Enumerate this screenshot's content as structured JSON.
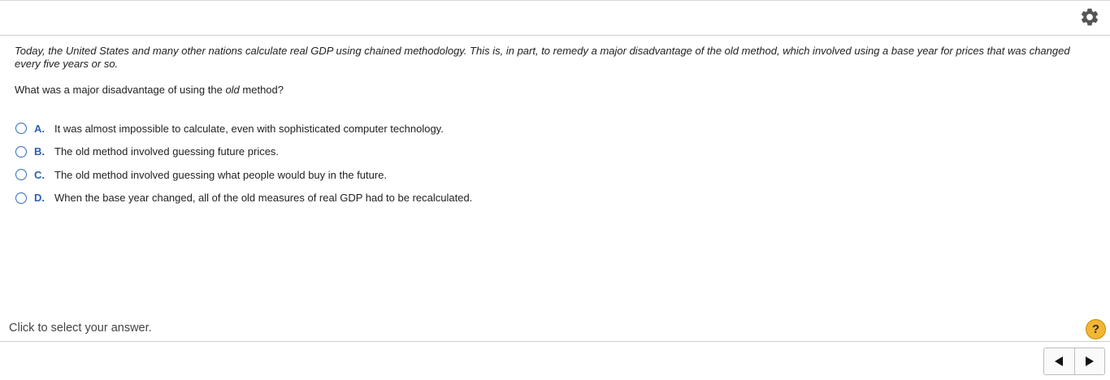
{
  "question": {
    "text": "Today, the United States and many other nations calculate real GDP using chained methodology. This is, in part, to remedy a major disadvantage of the old method, which involved using a base year for prices that was changed every five years or so.",
    "prompt_before": "What was a major disadvantage of using the ",
    "prompt_emphasis": "old",
    "prompt_after": " method?"
  },
  "options": [
    {
      "letter": "A.",
      "text": "It was almost impossible to calculate, even with sophisticated computer technology."
    },
    {
      "letter": "B.",
      "text": "The old method involved guessing future prices."
    },
    {
      "letter": "C.",
      "text": "The old method involved guessing what people would buy in the future."
    },
    {
      "letter": "D.",
      "text": "When the base year changed, all of the old measures of real GDP had to be recalculated."
    }
  ],
  "footer": {
    "status_text": "Click to select your answer.",
    "help_glyph": "?"
  },
  "icons": {
    "settings": "gear-icon",
    "help": "help-icon",
    "prev": "triangle-left-icon",
    "next": "triangle-right-icon"
  },
  "colors": {
    "accent": "#2e6dbf",
    "option_letter": "#2e5fb3",
    "help_bg": "#f2b632",
    "gear": "#555555"
  }
}
